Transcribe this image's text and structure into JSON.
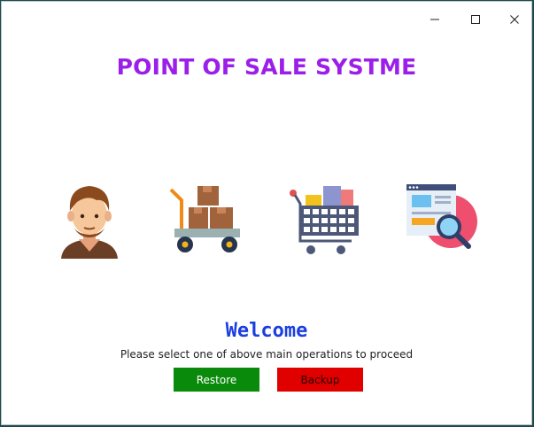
{
  "app": {
    "title": "POINT OF SALE SYSTME"
  },
  "window_controls": {
    "minimize": "minimize-icon",
    "maximize": "maximize-icon",
    "close": "close-icon"
  },
  "operations": [
    {
      "icon": "customer-icon"
    },
    {
      "icon": "hand-truck-boxes-icon"
    },
    {
      "icon": "shopping-cart-icon"
    },
    {
      "icon": "web-search-report-icon"
    }
  ],
  "welcome": {
    "heading": "Welcome",
    "message": "Please select one of above main operations to proceed"
  },
  "actions": {
    "restore_label": "Restore",
    "backup_label": "Backup"
  },
  "colors": {
    "title": "#9b1fe8",
    "welcome": "#1a3ee0",
    "restore": "#0a8a0a",
    "backup": "#e00000"
  }
}
